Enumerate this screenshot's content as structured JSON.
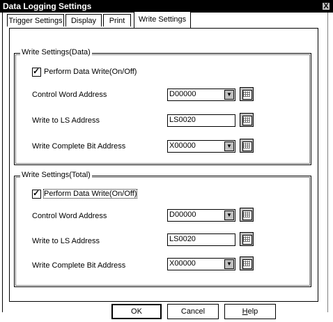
{
  "window": {
    "title": "Data Logging Settings",
    "close_glyph": "X"
  },
  "tabs": [
    {
      "label": "Trigger Settings"
    },
    {
      "label": "Display"
    },
    {
      "label": "Print"
    },
    {
      "label": "Write Settings"
    }
  ],
  "data_group": {
    "title": "Write Settings(Data)",
    "checkbox_label": "Perform Data Write(On/Off)",
    "checked": true,
    "control_word_label": "Control Word Address",
    "control_word_value": "D00000",
    "write_ls_label": "Write to LS Address",
    "write_ls_value": "LS0020",
    "complete_bit_label": "Write Complete Bit Address",
    "complete_bit_value": "X00000"
  },
  "total_group": {
    "title": "Write Settings(Total)",
    "checkbox_label": "Perform Data Write(On/Off)",
    "checked": true,
    "control_word_label": "Control Word Address",
    "control_word_value": "D00000",
    "write_ls_label": "Write to LS Address",
    "write_ls_value": "LS0020",
    "complete_bit_label": "Write Complete Bit Address",
    "complete_bit_value": "X00000"
  },
  "buttons": {
    "ok": "OK",
    "cancel": "Cancel",
    "help_prefix": "",
    "help_mnemonic": "H",
    "help_rest": "elp"
  },
  "icons": {
    "dropdown": "dropdown-arrow-icon",
    "keypad": "keypad-icon",
    "check": "checkmark-icon"
  }
}
